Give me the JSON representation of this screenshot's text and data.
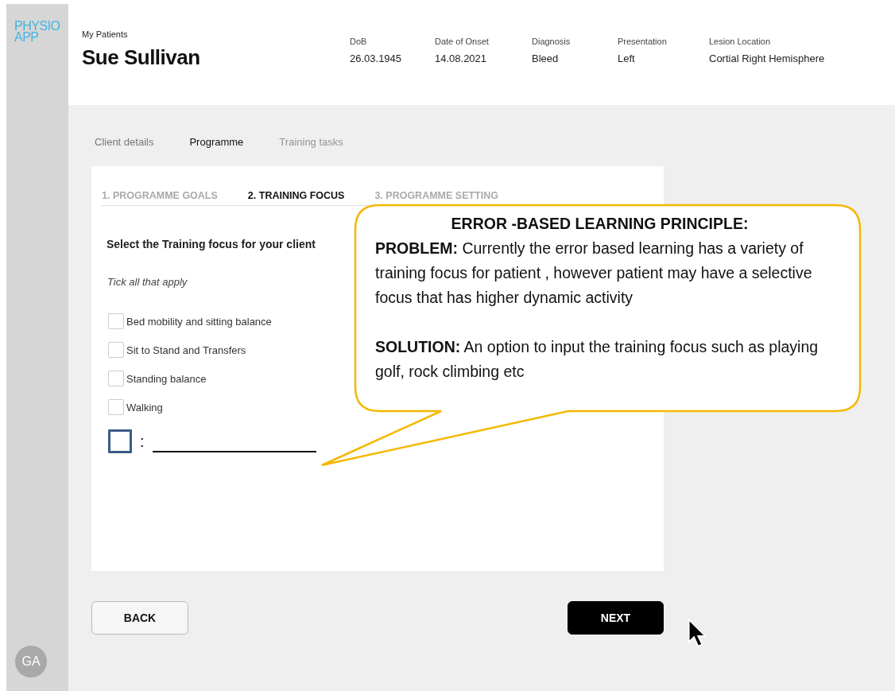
{
  "sidebar": {
    "logo": [
      "PHYSIO",
      "APP"
    ],
    "avatar": "GA"
  },
  "header": {
    "breadcrumb": "My Patients",
    "patient_name": "Sue Sullivan",
    "fields": [
      {
        "label": "DoB",
        "value": "26.03.1945"
      },
      {
        "label": "Date of Onset",
        "value": "14.08.2021"
      },
      {
        "label": "Diagnosis",
        "value": "Bleed"
      },
      {
        "label": "Presentation",
        "value": "Left"
      },
      {
        "label": "Lesion Location",
        "value": "Cortial Right Hemisphere"
      }
    ]
  },
  "tabs": [
    {
      "label": "Client details",
      "selected": false,
      "disabled": false
    },
    {
      "label": "Programme",
      "selected": true,
      "disabled": false
    },
    {
      "label": "Training tasks",
      "selected": false,
      "disabled": true
    }
  ],
  "steps": [
    {
      "label": "1. PROGRAMME GOALS",
      "selected": false
    },
    {
      "label": "2. TRAINING FOCUS",
      "selected": true
    },
    {
      "label": "3. PROGRAMME SETTING",
      "selected": false
    }
  ],
  "form": {
    "heading": "Select the Training focus for your client",
    "hint": "Tick all that apply",
    "options": [
      {
        "kind": "standard",
        "label": "Bed mobility and sitting balance",
        "checked": false
      },
      {
        "kind": "standard",
        "label": "Sit to Stand and Transfers",
        "checked": false
      },
      {
        "kind": "standard",
        "label": "Standing balance",
        "checked": false
      },
      {
        "kind": "standard",
        "label": "Walking",
        "checked": false
      },
      {
        "kind": "custom",
        "label": ":",
        "checked": false
      }
    ]
  },
  "callout": {
    "title": "ERROR -BASED LEARNING PRINCIPLE:",
    "paragraphs": [
      "**PROBLEM:** Currently the error based learning has a variety of training focus for patient , however patient may have a selective focus that has higher dynamic activity",
      "**SOLUTION:** An option to input the training focus such as playing golf, rock climbing etc"
    ]
  },
  "buttons": [
    {
      "kind": "secondary",
      "label": "BACK"
    },
    {
      "kind": "primary",
      "label": "NEXT"
    }
  ]
}
